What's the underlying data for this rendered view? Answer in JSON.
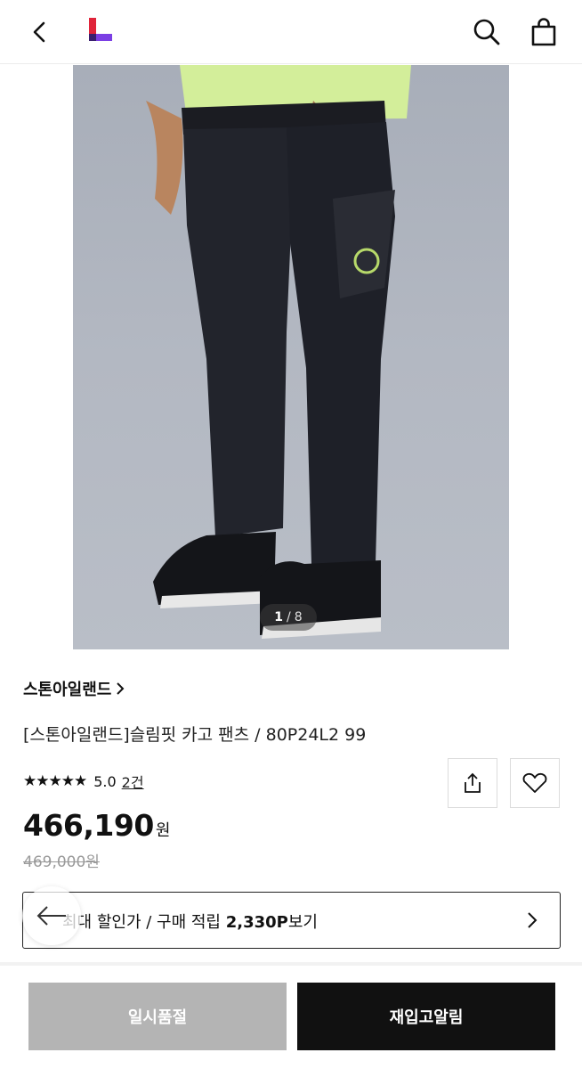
{
  "header": {
    "back_icon": "chevron-left-icon",
    "logo_icon": "lotte-on-logo",
    "search_icon": "search-icon",
    "bag_icon": "shopping-bag-icon"
  },
  "gallery": {
    "current": "1",
    "separator": "/",
    "total": "8"
  },
  "product": {
    "brand": "스톤아일랜드",
    "title": "[스톤아일랜드]슬림핏 카고 팬츠 / 80P24L2 99",
    "stars": "★★★★★",
    "rating": "5.0",
    "review_count": "2건",
    "price": "466,190",
    "currency": "원",
    "original_price": "469,000원"
  },
  "benefit": {
    "prefix": "최대 할인가 / 구매 적립 ",
    "points": "2,330P",
    "suffix": "보기"
  },
  "actions": {
    "soldout_label": "일시품절",
    "restock_label": "재입고알림"
  },
  "colors": {
    "accent_red": "#e0243a",
    "accent_purple": "#7b3fe4",
    "dark_button": "#111111",
    "disabled_button": "#b4b4b4"
  }
}
